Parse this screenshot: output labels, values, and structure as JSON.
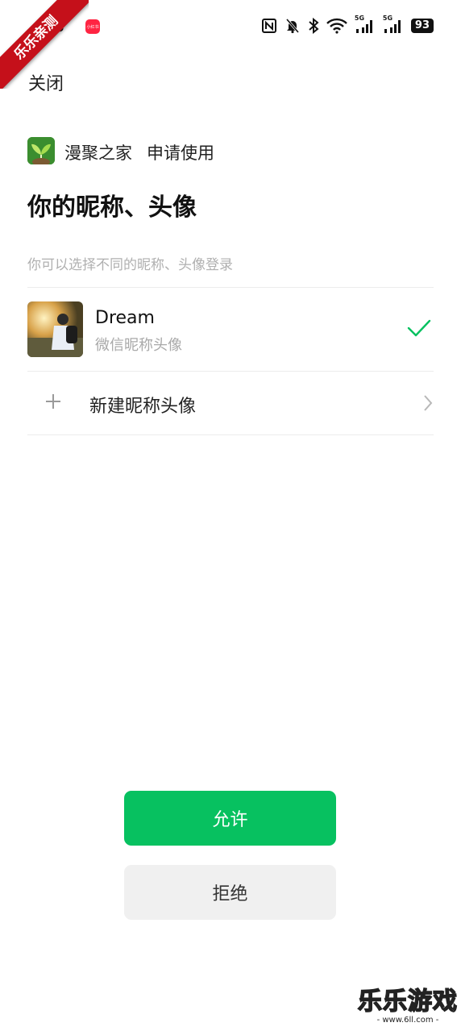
{
  "status_bar": {
    "time": "08",
    "notification_app": "小红书",
    "icons": [
      "nfc-icon",
      "bell-muted-icon",
      "bluetooth-icon",
      "wifi-icon",
      "signal-5g-icon",
      "signal-5g-icon"
    ],
    "signal_label_1": "5G",
    "signal_label_2": "5G",
    "battery": "93"
  },
  "watermark_corner": "乐乐亲测",
  "header": {
    "close": "关闭"
  },
  "app": {
    "name": "漫聚之家",
    "request": "申请使用"
  },
  "page": {
    "title": "你的昵称、头像",
    "hint": "你可以选择不同的昵称、头像登录"
  },
  "profile": {
    "name": "Dream",
    "subtitle": "微信昵称头像",
    "selected": true
  },
  "new_profile": {
    "label": "新建昵称头像"
  },
  "actions": {
    "allow": "允许",
    "deny": "拒绝"
  },
  "watermark_bottom": {
    "title": "乐乐游戏",
    "url": "- www.6ll.com -"
  },
  "colors": {
    "accent": "#07c160",
    "deny_bg": "#f0f0f0",
    "hint": "#b0b0b0"
  }
}
